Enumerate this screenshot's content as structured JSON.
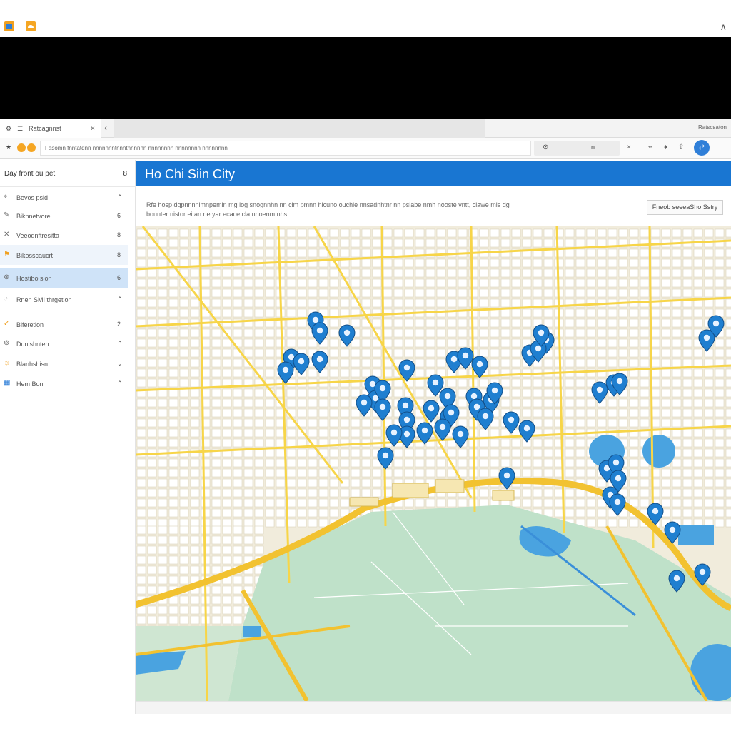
{
  "browser": {
    "tab_title": "Ratcagnnst",
    "tab_right_label": "Ratscsaton",
    "url": "Fasomn fnntatdnn nnnnnnntnnntnnnnnn nnnnnnnn nnnnnnnn nnnnnnnn",
    "search_right_text": "n"
  },
  "sidebar": {
    "header": "Day front ou pet",
    "header_count": "8",
    "items": [
      {
        "icon": "pin-icon",
        "label": "Bevos psid",
        "count": "⌃"
      },
      {
        "icon": "tag-icon",
        "label": "Biknnetvore",
        "count": "6"
      },
      {
        "icon": "star-icon",
        "label": "Veeodnftresitta",
        "count": "8"
      },
      {
        "icon": "fork-icon",
        "label": "Bikosscaucrt",
        "count": "8"
      },
      {
        "icon": "compass-icon",
        "label": "Hostibo sion",
        "count": "6"
      },
      {
        "icon": "clock-icon",
        "label": "Rnen SMI thrgetion",
        "count": "⌃"
      },
      {
        "icon": "flag-icon",
        "label": "Biferetion",
        "count": "2"
      },
      {
        "icon": "target-icon",
        "label": "Dunishnten",
        "count": "⌃"
      },
      {
        "icon": "sun-icon",
        "label": "Blanhshisn",
        "count": "⌄"
      },
      {
        "icon": "grid-icon",
        "label": "Hem Bon",
        "count": "⌃"
      }
    ]
  },
  "main": {
    "title": "Ho Chi Siin City",
    "description": "Rfe hosp dgpnnnnimnpemin mg log snognnhn nn cim pmnn hlcuno ouchie nnsadnhtnr nn pslabe nmh nooste vntt, clawe mis dg bounter nistor eitan ne yar ecace cla nnoenm nhs.",
    "safety_button": "Fneob seeeaSho Sstry"
  },
  "map": {
    "colors": {
      "land": "#f1ecdc",
      "block": "#ffffff",
      "road": "#f7d548",
      "major_road": "#f2c230",
      "water": "#4aa3e0",
      "park": "#bfe1c9",
      "pin": "#1f7fd0"
    }
  }
}
